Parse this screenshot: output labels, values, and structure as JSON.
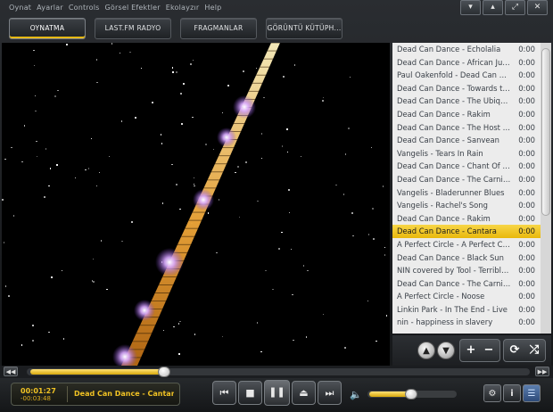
{
  "menu": [
    "Oynat",
    "Ayarlar",
    "Controls",
    "Görsel Efektler",
    "Ekolayzır",
    "Help"
  ],
  "window_controls": [
    "▾",
    "▴",
    "⤢",
    "✕"
  ],
  "tabs": [
    {
      "label": "OYNATMA",
      "active": true
    },
    {
      "label": "LAST.FM RADYO",
      "active": false
    },
    {
      "label": "FRAGMANLAR",
      "active": false
    },
    {
      "label": "GÖRÜNTÜ KÜTÜPH...",
      "active": false
    }
  ],
  "playlist": [
    {
      "title": "Dead Can Dance - Echolalia",
      "duration": "0:00"
    },
    {
      "title": "Dead Can Dance - African Jungle",
      "duration": "0:00"
    },
    {
      "title": "Paul Oakenfold - Dead Can Dance",
      "duration": "0:00"
    },
    {
      "title": "Dead Can Dance - Towards the Within",
      "duration": "0:00"
    },
    {
      "title": "Dead Can Dance - The Ubiquitous",
      "duration": "0:00"
    },
    {
      "title": "Dead Can Dance - Rakim",
      "duration": "0:00"
    },
    {
      "title": "Dead Can Dance - The Host of Seraphim",
      "duration": "0:00"
    },
    {
      "title": "Dead Can Dance - Sanvean",
      "duration": "0:00"
    },
    {
      "title": "Vangelis - Tears In Rain",
      "duration": "0:00"
    },
    {
      "title": "Dead Can Dance - Chant Of The Paladin",
      "duration": "0:00"
    },
    {
      "title": "Dead Can Dance - The Carnival Is Over",
      "duration": "0:00"
    },
    {
      "title": "Vangelis - Bladerunner Blues",
      "duration": "0:00"
    },
    {
      "title": "Vangelis - Rachel's Song",
      "duration": "0:00"
    },
    {
      "title": "Dead Can Dance - Rakim",
      "duration": "0:00"
    },
    {
      "title": "Dead Can Dance - Cantara",
      "duration": "0:00",
      "selected": true
    },
    {
      "title": "A Perfect Circle - A Perfect Circle",
      "duration": "0:00"
    },
    {
      "title": "Dead Can Dance - Black Sun",
      "duration": "0:00"
    },
    {
      "title": "NIN covered by Tool - Terrible Lie",
      "duration": "0:00"
    },
    {
      "title": "Dead Can Dance - The Carnival Is Over",
      "duration": "0:00"
    },
    {
      "title": "A Perfect Circle - Noose",
      "duration": "0:00"
    },
    {
      "title": "Linkin Park - In The End - Live",
      "duration": "0:00"
    },
    {
      "title": "nin - happiness in slavery",
      "duration": "0:00"
    }
  ],
  "playlist_controls": {
    "up": "▲",
    "down": "▼",
    "add": "+",
    "remove": "−",
    "repeat": "⟳",
    "shuffle": "⤮"
  },
  "seek": {
    "left": "◀◀",
    "right": "▶▶",
    "progress": 0.27
  },
  "now_playing": {
    "elapsed": "00:01:27",
    "remaining": "-00:03:48",
    "title": "Dead Can Dance - Cantara"
  },
  "transport": {
    "prev": "⏮",
    "stop": "■",
    "pause": "❚❚",
    "eject": "⏏",
    "next": "⏭"
  },
  "volume": {
    "icon": "🔈",
    "level": 0.48
  },
  "right_buttons": {
    "settings": "⚙",
    "info": "i",
    "playlist": "☰"
  },
  "colors": {
    "accent": "#e9b80c",
    "selected_row": "#f4cc2e"
  }
}
